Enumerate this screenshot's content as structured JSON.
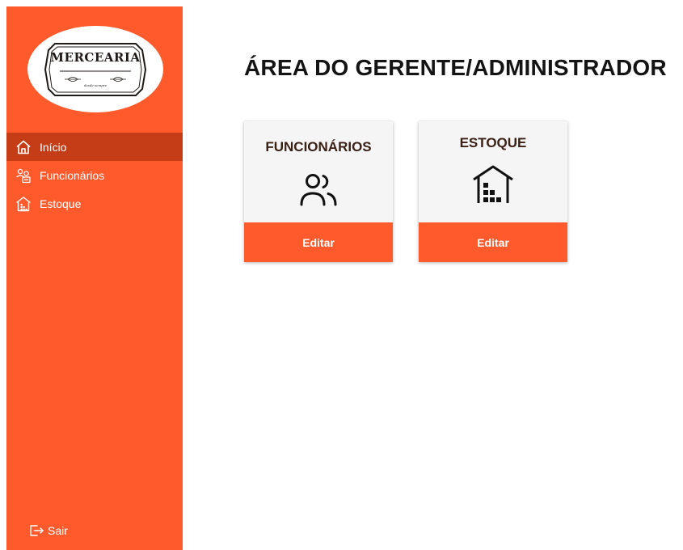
{
  "brand": {
    "logo_text": "MERCEARIA",
    "logo_subtext": "desde sempre"
  },
  "sidebar": {
    "items": [
      {
        "label": "Início",
        "icon": "home-icon",
        "active": true
      },
      {
        "label": "Funcionários",
        "icon": "users-icon",
        "active": false
      },
      {
        "label": "Estoque",
        "icon": "warehouse-icon",
        "active": false
      }
    ],
    "logout_label": "Sair",
    "logout_icon": "logout-icon"
  },
  "main": {
    "title": "ÁREA DO GERENTE/ADMINISTRADOR",
    "cards": [
      {
        "title": "FUNCIONÁRIOS",
        "icon": "users-icon",
        "button_label": "Editar"
      },
      {
        "title": "ESTOQUE",
        "icon": "warehouse-icon",
        "button_label": "Editar"
      }
    ]
  },
  "colors": {
    "sidebar_bg": "#ff5a2c",
    "sidebar_active": "#c43d16",
    "card_bg": "#f5f5f5",
    "card_title": "#3a2116",
    "button_bg": "#ff5a2c"
  }
}
